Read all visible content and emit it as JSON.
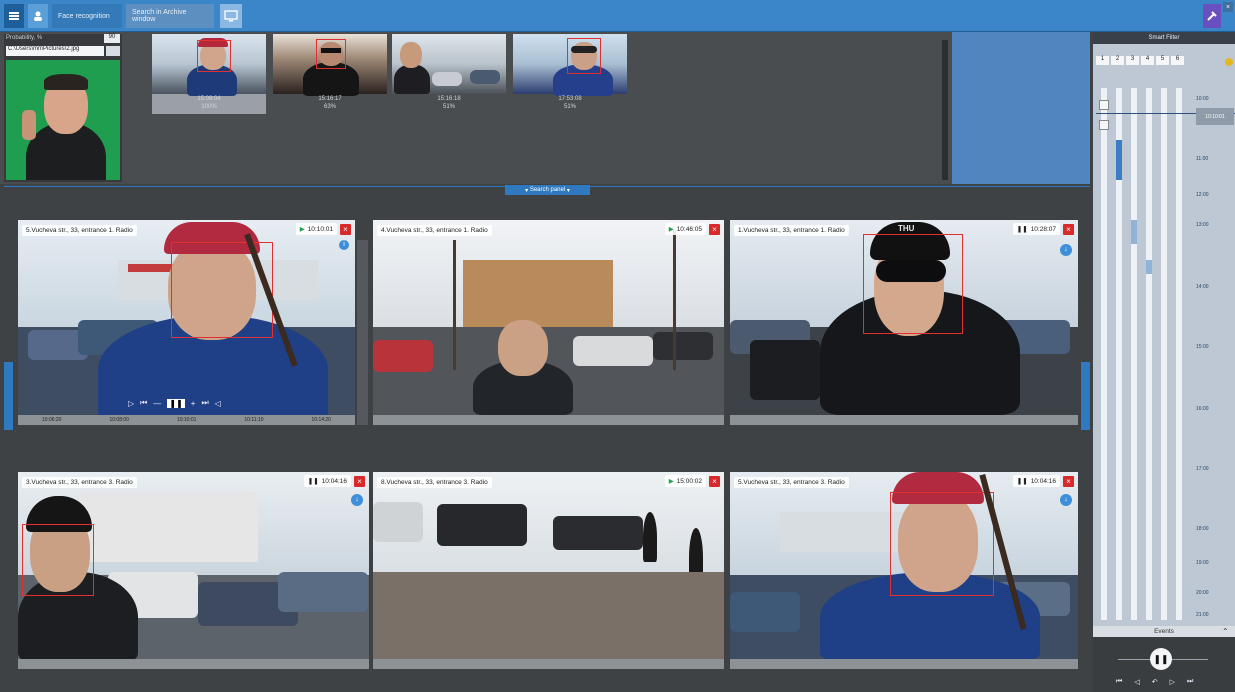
{
  "topbar": {
    "tab_active": "Face recognition",
    "tab_second": "Search in Archive window"
  },
  "reference": {
    "label": "Probability, %",
    "threshold": "90",
    "file_path": "C:\\Users\\mn\\Pictures\\2.jpg"
  },
  "results": [
    {
      "time": "15:08:04",
      "score": "100%"
    },
    {
      "time": "15:16:17",
      "score": "63%"
    },
    {
      "time": "15:16:18",
      "score": "51%"
    },
    {
      "time": "17:53:08",
      "score": "51%"
    }
  ],
  "search_panel_label": "Search panel",
  "cameras": [
    {
      "title": "5.Vucheva str., 33, entrance 1. Radio",
      "time": "10:10:01",
      "mode": "play"
    },
    {
      "title": "4.Vucheva str., 33, entrance 1. Radio",
      "time": "10:46:05",
      "mode": "play"
    },
    {
      "title": "1.Vucheva str., 33, entrance 1. Radio",
      "time": "10:28:07",
      "mode": "pause"
    },
    {
      "title": "3.Vucheva str., 33, entrance 3. Radio",
      "time": "10:04:16",
      "mode": "pause"
    },
    {
      "title": "8.Vucheva str., 33, entrance 3. Radio",
      "time": "15:00:02",
      "mode": "play"
    },
    {
      "title": "5.Vucheva str., 33, entrance 3. Radio",
      "time": "10:04:16",
      "mode": "pause"
    }
  ],
  "playback_times": [
    "10:06:20",
    "10:08:00",
    "10:10:01",
    "10:11:10",
    "10:14:20"
  ],
  "timeline": {
    "title": "Smart Filter",
    "columns": [
      "1",
      "2",
      "3",
      "4",
      "5",
      "6"
    ],
    "hour_labels": [
      "10:00",
      "11:00",
      "12:00",
      "13:00",
      "14:00",
      "15:00",
      "16:00",
      "17:00",
      "18:00",
      "19:00",
      "20:00",
      "21:00"
    ],
    "current": "10:10:01"
  },
  "events_title": "Events",
  "watermark_text": "THU",
  "icons": [
    "layout-icon",
    "user-icon",
    "monitor-icon",
    "settings-icon",
    "play-icon",
    "pause-icon",
    "close-icon",
    "info-icon"
  ]
}
